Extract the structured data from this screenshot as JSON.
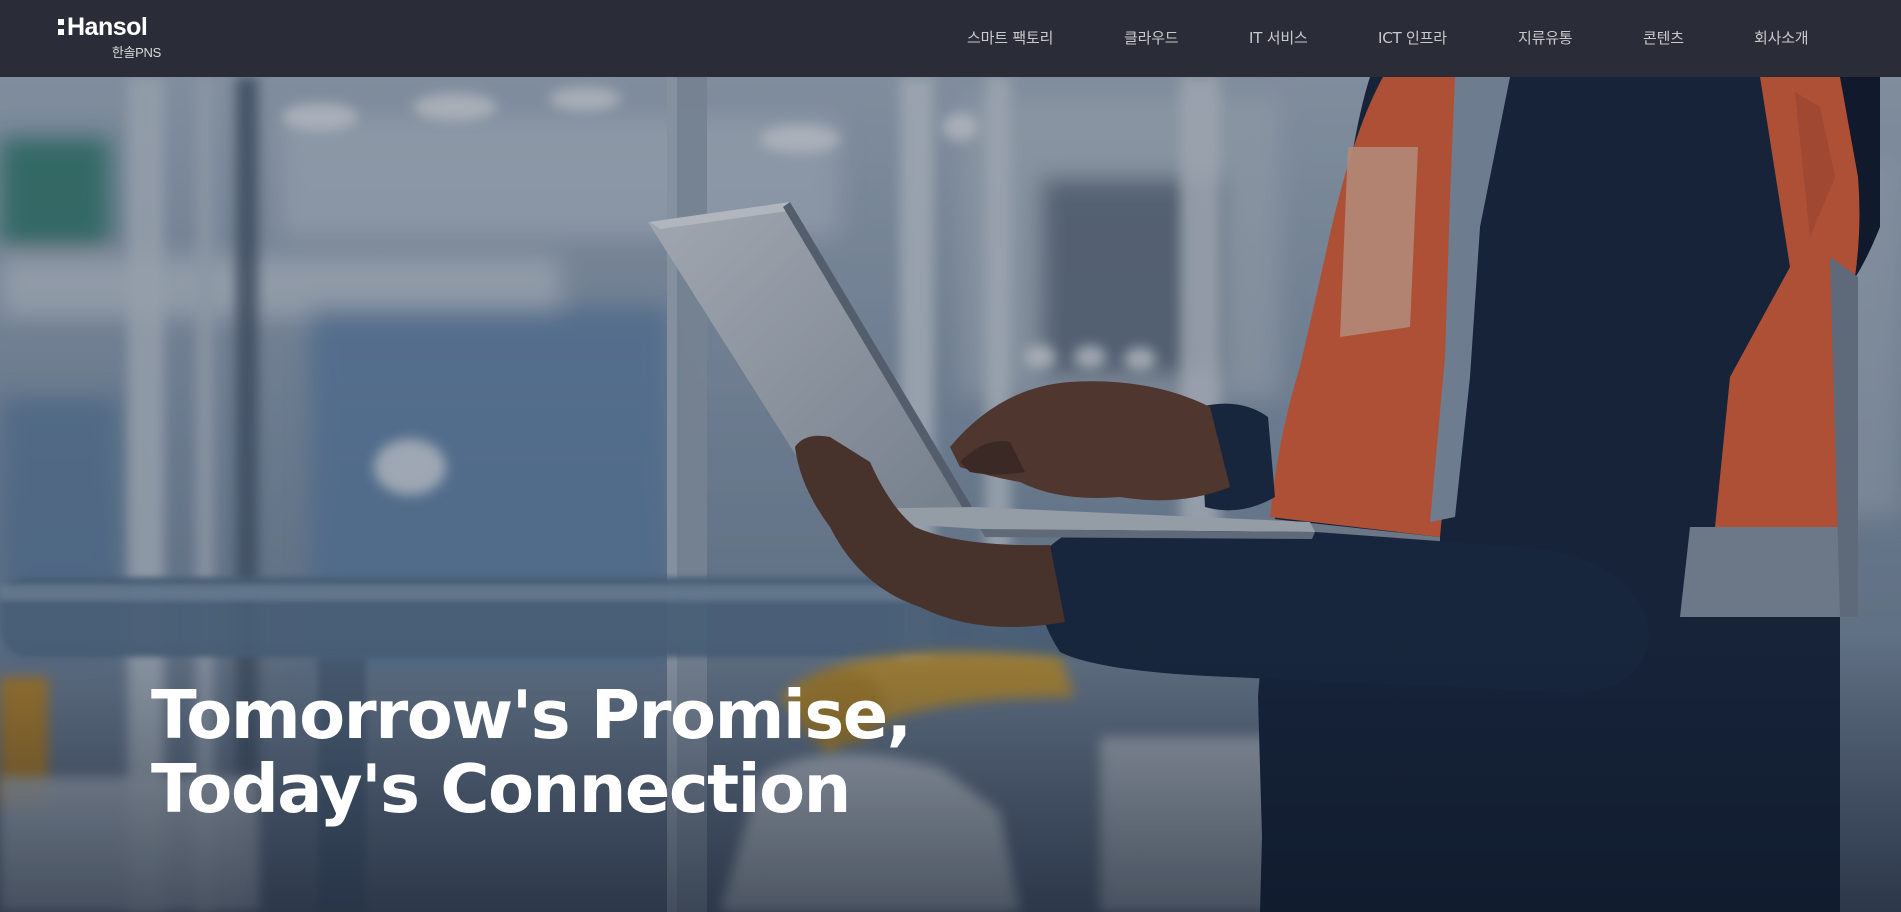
{
  "header": {
    "logo": {
      "brand": "Hansol",
      "sub": "한솔PNS"
    },
    "nav": [
      {
        "label": "스마트 팩토리"
      },
      {
        "label": "클라우드"
      },
      {
        "label": "IT 서비스"
      },
      {
        "label": "ICT 인프라"
      },
      {
        "label": "지류유통"
      },
      {
        "label": "콘텐츠"
      },
      {
        "label": "회사소개"
      }
    ]
  },
  "hero": {
    "title_line1": "Tomorrow's Promise,",
    "title_line2": "Today's Connection",
    "image_subject": "worker-with-laptop-in-factory-photo"
  },
  "colors": {
    "header_bg": "#2a2d38",
    "nav_text": "#c9cacd",
    "vest_orange": "#e8643a",
    "jacket_navy": "#17263d"
  }
}
